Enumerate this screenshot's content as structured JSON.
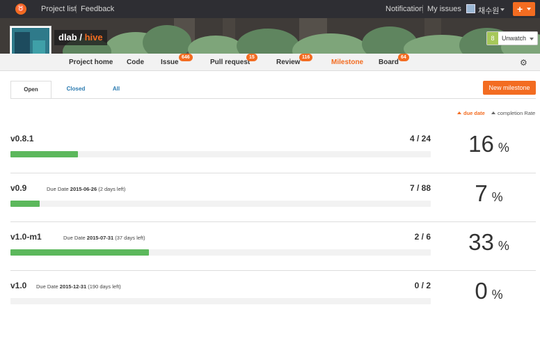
{
  "topbar": {
    "logo_glyph": "♉",
    "project_list": "Project list",
    "feedback": "Feedback",
    "notification": "Notification",
    "my_issues": "My issues",
    "user_name": "채수원",
    "plus_label": "+"
  },
  "project": {
    "owner": "dlab",
    "separator": "/",
    "name": "hive",
    "watch_count": "8",
    "watch_label": "Unwatch"
  },
  "nav": {
    "items": [
      {
        "label": "Project home"
      },
      {
        "label": "Code"
      },
      {
        "label": "Issue",
        "badge": "646"
      },
      {
        "label": "Pull request",
        "badge": "15"
      },
      {
        "label": "Review",
        "badge": "116"
      },
      {
        "label": "Milestone"
      },
      {
        "label": "Board",
        "badge": "64"
      }
    ],
    "active": "Milestone",
    "settings_icon": "gear-icon"
  },
  "tabs": {
    "open": "Open",
    "closed": "Closed",
    "all": "All",
    "new_milestone": "New milestone"
  },
  "sort": {
    "due_date": "due date",
    "completion_rate": "completion Rate"
  },
  "milestones": [
    {
      "title": "v0.8.1",
      "due_label": "",
      "due_date": "",
      "due_left": "",
      "count": "4 / 24",
      "percent_value": "16",
      "percent_sign": "%",
      "progress": 0.16
    },
    {
      "title": "v0.9",
      "due_label": "Due Date",
      "due_date": "2015-06-26",
      "due_left": "(2 days left)",
      "count": "7 / 88",
      "percent_value": "7",
      "percent_sign": "%",
      "progress": 0.07
    },
    {
      "title": "v1.0-m1",
      "due_label": "Due Date",
      "due_date": "2015-07-31",
      "due_left": "(37 days left)",
      "count": "2 / 6",
      "percent_value": "33",
      "percent_sign": "%",
      "progress": 0.33
    },
    {
      "title": "v1.0",
      "due_label": "Due Date",
      "due_date": "2015-12-31",
      "due_left": "(190 days left)",
      "count": "0 / 2",
      "percent_value": "0",
      "percent_sign": "%",
      "progress": 0.0
    }
  ],
  "colors": {
    "accent": "#f36c21",
    "progress": "#5cb85c",
    "link": "#2a7ab0"
  }
}
